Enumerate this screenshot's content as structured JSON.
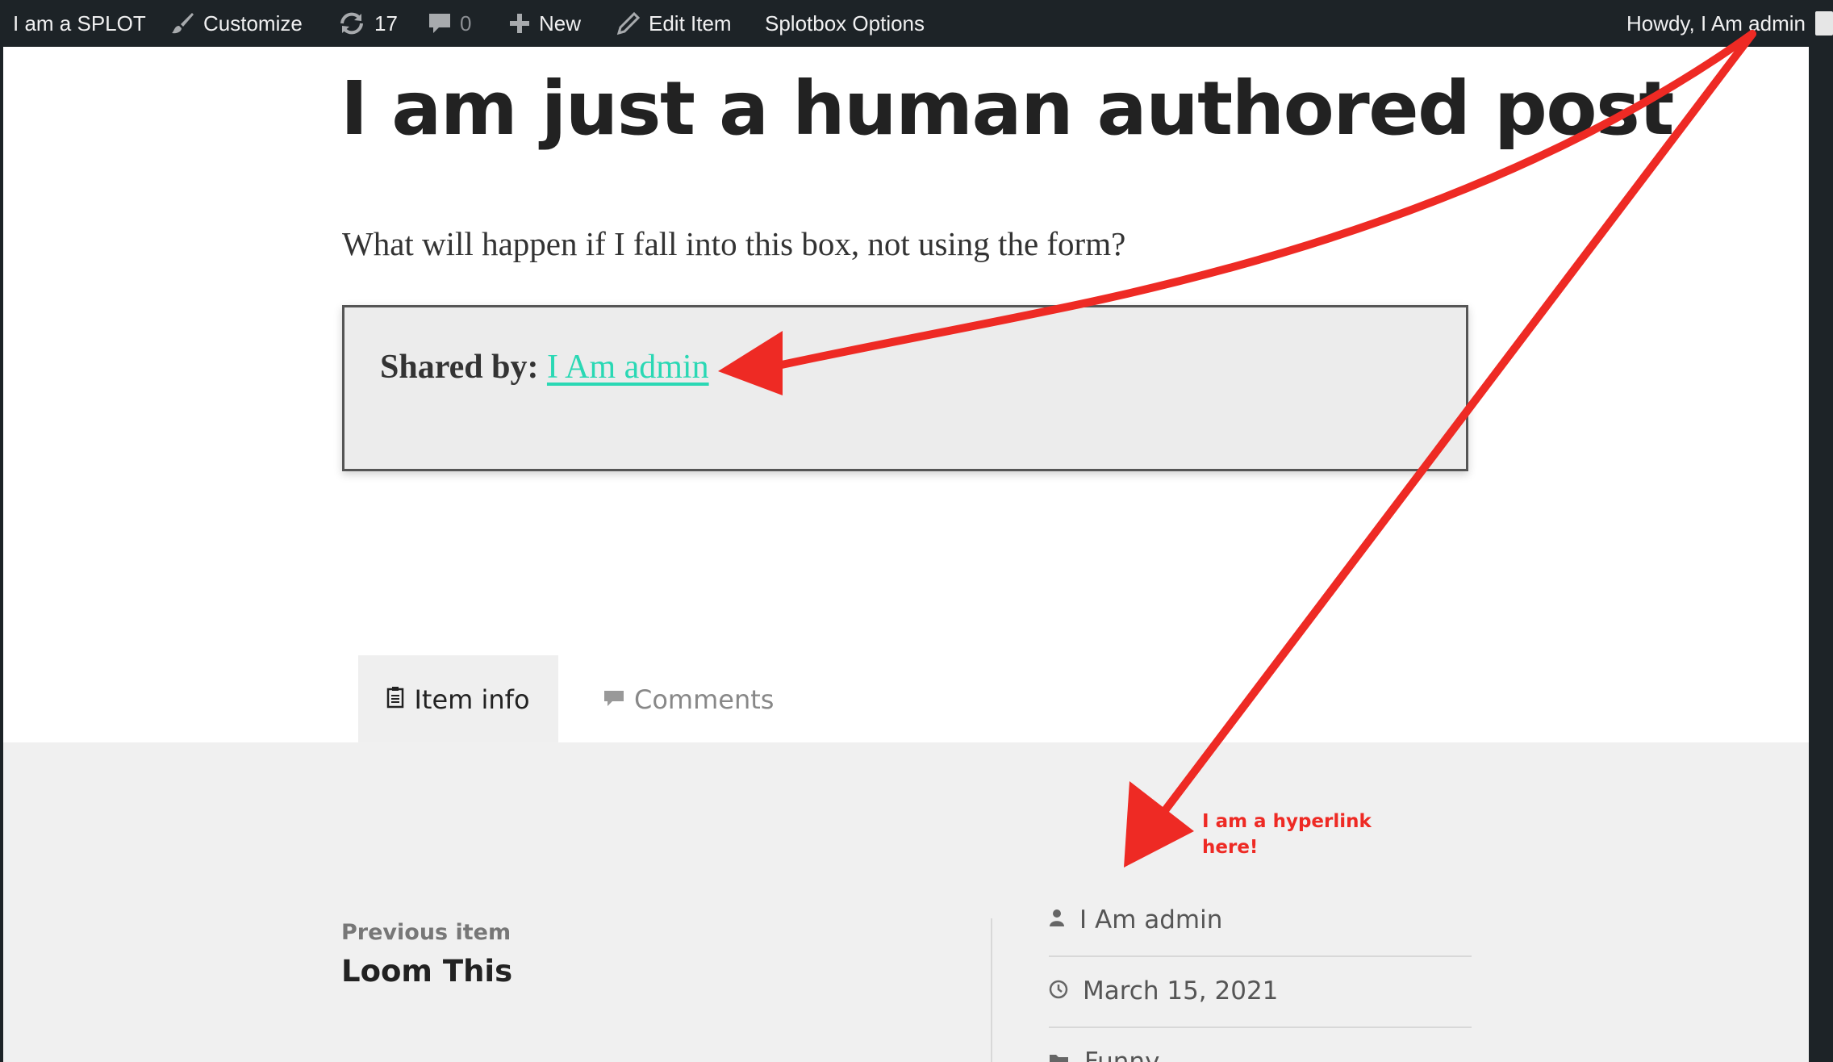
{
  "adminbar": {
    "site_name": "I am a SPLOT",
    "customize": "Customize",
    "updates_count": "17",
    "comments_count": "0",
    "new_label": "New",
    "edit_label": "Edit Item",
    "options_label": "Splotbox Options",
    "howdy": "Howdy, I Am admin"
  },
  "post": {
    "title": "I am just a human authored post",
    "intro": "What will happen if I fall into this box, not using the form?",
    "shared_by_label": "Shared by:",
    "shared_by_name": "I Am admin"
  },
  "tabs": [
    {
      "label": "Item info",
      "icon": "clipboard-icon",
      "active": true
    },
    {
      "label": "Comments",
      "icon": "speech-bubble-icon",
      "active": false
    }
  ],
  "navigation": {
    "previous_label": "Previous item",
    "previous_title": "Loom This"
  },
  "meta": {
    "author": "I Am admin",
    "date": "March 15, 2021",
    "category": "Funny"
  },
  "annotation": {
    "note": "I am a hyperlink here!",
    "color": "#ee2a24"
  },
  "colors": {
    "link": "#2ad8b4",
    "admin_bar": "#1d2327"
  }
}
